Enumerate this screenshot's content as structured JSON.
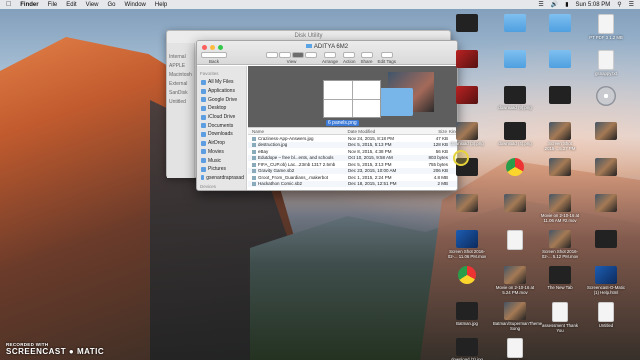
{
  "menubar": {
    "app": "Finder",
    "items": [
      "File",
      "Edit",
      "View",
      "Go",
      "Window",
      "Help"
    ],
    "clock": "Sun 5:08 PM"
  },
  "disk_utility": {
    "title": "Disk Utility",
    "sidebar": [
      "Internal",
      "APPLE",
      "Macintosh",
      "External",
      "SanDisk",
      "Untitled"
    ]
  },
  "finder": {
    "title": "ADITYA 6M2",
    "toolbar": [
      "Back",
      "View",
      "Arrange",
      "Action",
      "Share",
      "Edit Tags"
    ],
    "favorites_header": "Favorites",
    "sidebar": [
      "All My Files",
      "Applications",
      "Google Drive",
      "Desktop",
      "iCloud Drive",
      "Documents",
      "Downloads",
      "AirDrop",
      "Movies",
      "Music",
      "Pictures",
      "gsenardraprasad"
    ],
    "devices_header": "Devices",
    "preview_label": "6 panels.png",
    "columns": {
      "name": "Name",
      "date": "Date Modified",
      "size": "Size",
      "kind": "Kind"
    },
    "rows": [
      {
        "name": "Craziness-App-Answers.jpg",
        "date": "Nov 24, 2015, 8:18 PM",
        "size": "47 KB"
      },
      {
        "name": "destruction.jpg",
        "date": "Dec 5, 2015, 5:13 PM",
        "size": "128 KB"
      },
      {
        "name": "eBay",
        "date": "Nov 8, 2015, 4:38 PM",
        "size": "56 KB"
      },
      {
        "name": "Edutdope – free bl...ents, and schools",
        "date": "Oct 10, 2015, 9:58 AM",
        "size": "803 bytes"
      },
      {
        "name": "FIFA_CUP.ob) Lac...23mb 1317 2.5mb",
        "date": "Dec 5, 2015, 3:13 PM",
        "size": "755 bytes"
      },
      {
        "name": "Gravity Game.sb2",
        "date": "Dec 23, 2015, 10:00 AM",
        "size": "206 KB"
      },
      {
        "name": "Groot_From_Guardians_.makerbot",
        "date": "Dec 1, 2015, 2:24 PM",
        "size": "4.8 MB"
      },
      {
        "name": "Hackathon Comic.sb2",
        "date": "Dec 18, 2015, 12:51 PM",
        "size": "2 MB"
      }
    ]
  },
  "desktop_icons": [
    {
      "label": "",
      "kind": "dark"
    },
    {
      "label": "",
      "kind": "folder"
    },
    {
      "label": "",
      "kind": "folder"
    },
    {
      "label": "PT PDF 3 1.2 MB",
      "kind": "doc"
    },
    {
      "label": "",
      "kind": "red"
    },
    {
      "label": "",
      "kind": "folder"
    },
    {
      "label": "",
      "kind": "folder"
    },
    {
      "label": "gsnappy.txt",
      "kind": "doc"
    },
    {
      "label": "",
      "kind": "red"
    },
    {
      "label": "download (9).png",
      "kind": "dark"
    },
    {
      "label": "",
      "kind": "dark"
    },
    {
      "label": "",
      "kind": "disc"
    },
    {
      "label": "download (3).png",
      "kind": "photo"
    },
    {
      "label": "download (4).png",
      "kind": "dark"
    },
    {
      "label": "Screen Shot 2015-...5.27 PM",
      "kind": "photo"
    },
    {
      "label": "",
      "kind": "photo"
    },
    {
      "label": "",
      "kind": "dark"
    },
    {
      "label": "",
      "kind": "chrome"
    },
    {
      "label": "",
      "kind": "photo"
    },
    {
      "label": "",
      "kind": "photo"
    },
    {
      "label": "",
      "kind": "photo"
    },
    {
      "label": "",
      "kind": "photo"
    },
    {
      "label": "Movie on 2-10-16 at 11.06 AM #2.mov",
      "kind": "photo"
    },
    {
      "label": "",
      "kind": "photo"
    },
    {
      "label": "Screen Shot 2016-02-... 11.06 PM.mov",
      "kind": "blue"
    },
    {
      "label": "",
      "kind": "doc"
    },
    {
      "label": "Screen Shot 2016-02-... 5.12 PM.mov",
      "kind": "photo"
    },
    {
      "label": "",
      "kind": "dark"
    },
    {
      "label": "",
      "kind": "chrome"
    },
    {
      "label": "Movie on 2-10-16 at 5.24 PM.mov",
      "kind": "photo"
    },
    {
      "label": "The New Tab",
      "kind": "dark"
    },
    {
      "label": "Screencast-O-Matic (1) Help.html",
      "kind": "blue"
    },
    {
      "label": "Batman.jpg",
      "kind": "dark"
    },
    {
      "label": "Batman/SupermanTheme Song",
      "kind": "photo"
    },
    {
      "label": "assessment Thank You",
      "kind": "doc"
    },
    {
      "label": "Untitled",
      "kind": "doc"
    },
    {
      "label": "download (2).jpg",
      "kind": "dark"
    },
    {
      "label": "Gameshow",
      "kind": "doc"
    }
  ],
  "watermark": {
    "line1": "RECORDED WITH",
    "line2": "SCREENCAST",
    "line3": "MATIC"
  }
}
